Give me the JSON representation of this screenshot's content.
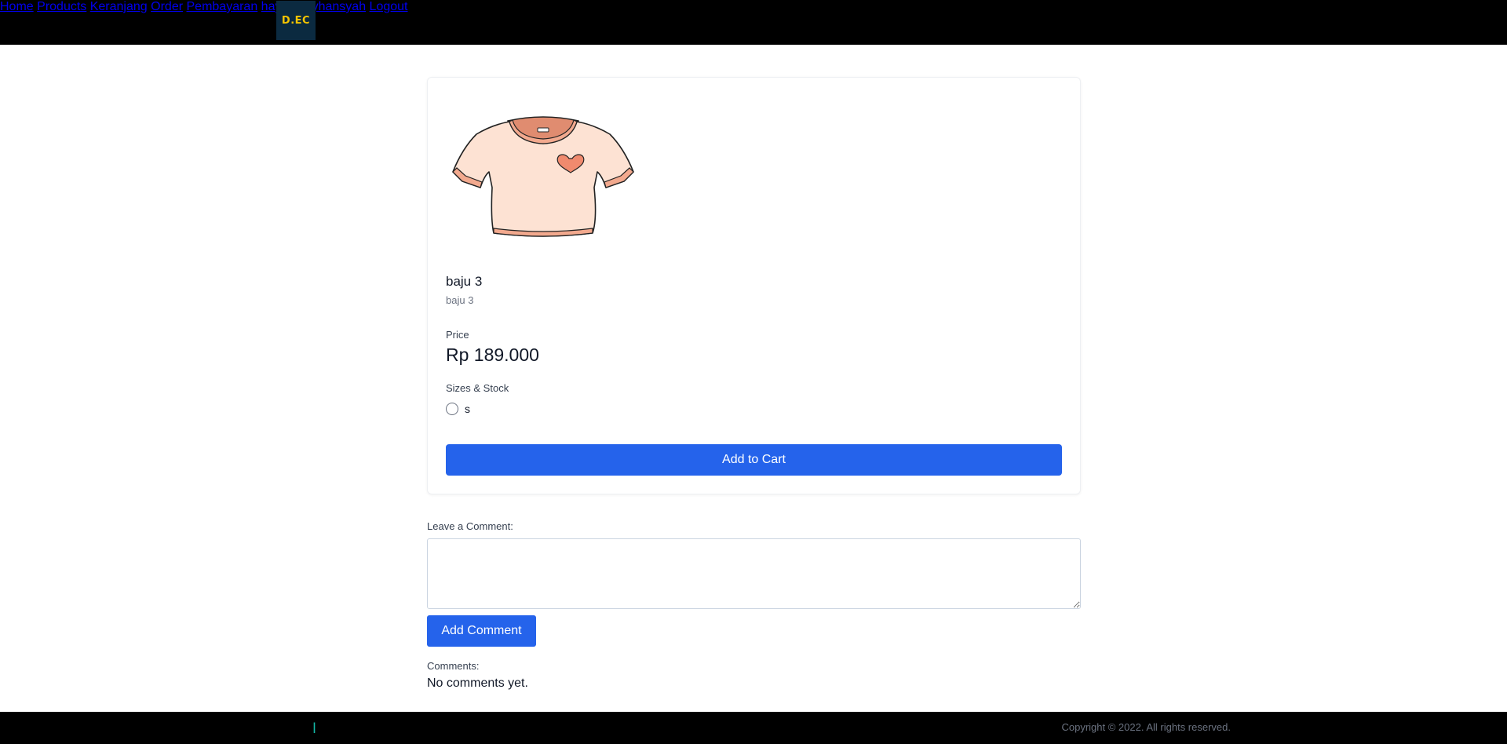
{
  "brand": {
    "logo_text": "D.EC"
  },
  "nav": {
    "items": [
      "Home",
      "Products",
      "Keranjang",
      "Order",
      "Pembayaran",
      "haycal rayhansyah",
      "Logout"
    ]
  },
  "product": {
    "image_icon": "tshirt-image",
    "name": "baju 3",
    "description": "baju 3",
    "price_label": "Price",
    "price": "Rp 189.000",
    "sizes_label": "Sizes & Stock",
    "sizes": [
      {
        "label": "s",
        "selected": false
      }
    ],
    "add_to_cart_label": "Add to Cart"
  },
  "comment_form": {
    "label": "Leave a Comment:",
    "value": "",
    "submit_label": "Add Comment"
  },
  "comments": {
    "title": "Comments:",
    "empty_text": "No comments yet."
  },
  "footer": {
    "mark": "l",
    "copyright": "Copyright © 2022. All rights reserved."
  },
  "colors": {
    "navbar": "#000000",
    "primary_button": "#2563eb",
    "logo_bg": "#0b2a40",
    "logo_text": "#f4c400"
  }
}
